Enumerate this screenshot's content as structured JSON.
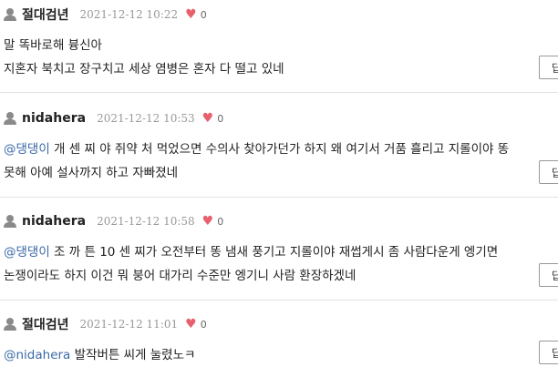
{
  "comments": [
    {
      "author": "절대검년",
      "date": "2021-12-12 10:22",
      "likes": "0",
      "mention": "",
      "lines": [
        "말 똑바로해 븅신아",
        "지혼자 북치고 장구치고 세상 염병은 혼자 다 떨고 있네"
      ],
      "reply_label": "답"
    },
    {
      "author": "nidahera",
      "date": "2021-12-12 10:53",
      "likes": "0",
      "mention": "@댕댕이",
      "lines": [
        " 개 센 찌 야 쥐약 처 먹었으면 수의사 찾아가던가 하지 왜 여기서 거품 흘리고 지롤이야 똥",
        "못해 아예 설사까지 하고 자빠졌네"
      ],
      "reply_label": "답"
    },
    {
      "author": "nidahera",
      "date": "2021-12-12 10:58",
      "likes": "0",
      "mention": "@댕댕이",
      "lines": [
        " 조 까 튼 10 센 찌가 오전부터 똥 냄새 풍기고 지롤이야 재썹게시 좀 사람다운게 엥기면",
        "논쟁이라도 하지 이건 뭐 붕어 대가리 수준만 엥기니 사람 환장하겠네"
      ],
      "reply_label": "답"
    },
    {
      "author": "절대검년",
      "date": "2021-12-12 11:01",
      "likes": "0",
      "mention": "@nidahera",
      "lines": [
        " 발작버튼 씨게 눌렸노ㅋ"
      ],
      "reply_label": "답"
    }
  ],
  "colors": {
    "heart": "#e8606e",
    "mention": "#3b6aa8",
    "date": "#999999"
  }
}
